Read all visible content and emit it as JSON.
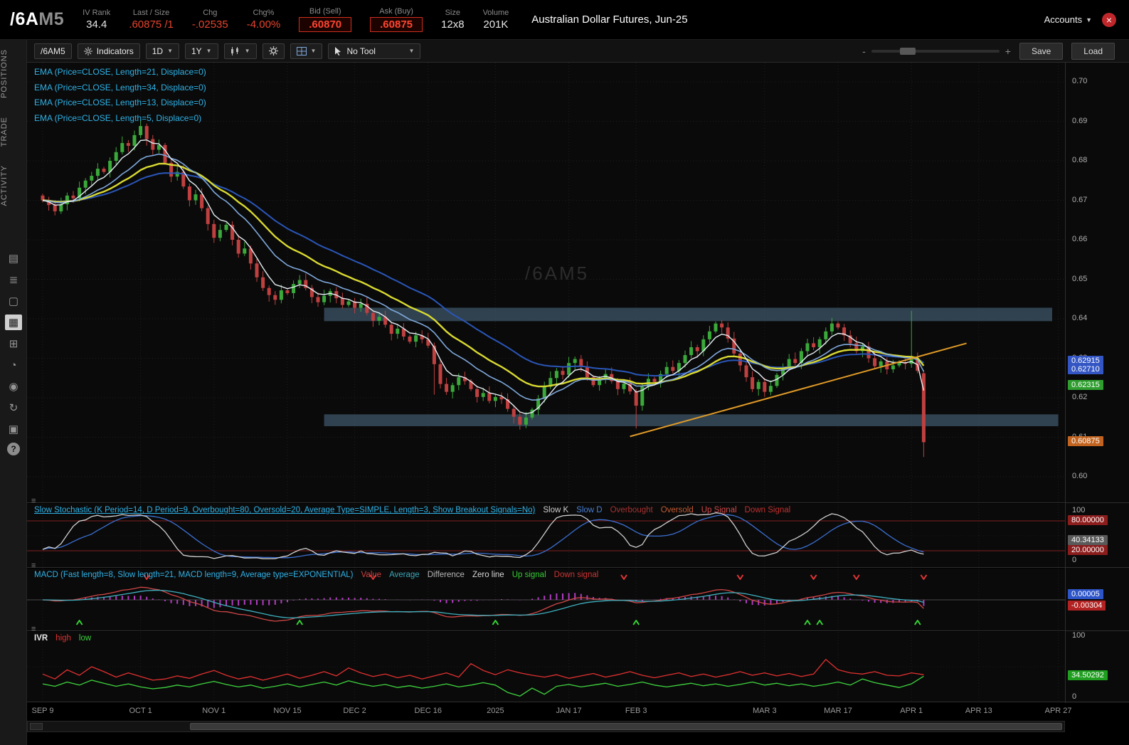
{
  "icons": {
    "caret": "▼",
    "minus": "-",
    "plus": "+",
    "close": "×"
  },
  "header": {
    "symbol_root": "/6A",
    "symbol_suffix": "M5",
    "fields": [
      {
        "label": "IV Rank",
        "value": "34.4"
      },
      {
        "label": "Last / Size",
        "value": ".60875 /1"
      },
      {
        "label": "Chg",
        "value": "-.02535"
      },
      {
        "label": "Chg%",
        "value": "-4.00%"
      },
      {
        "label": "Bid (Sell)",
        "value": ".60870"
      },
      {
        "label": "Ask (Buy)",
        "value": ".60875"
      },
      {
        "label": "Size",
        "value": "12x8"
      },
      {
        "label": "Volume",
        "value": "201K"
      }
    ],
    "description": "Australian Dollar Futures, Jun-25",
    "accounts_label": "Accounts"
  },
  "sidebar": {
    "tabs": [
      "POSITIONS",
      "TRADE",
      "ACTIVITY"
    ],
    "icons": [
      {
        "name": "monitor-icon",
        "glyph": "▤"
      },
      {
        "name": "watchlist-icon",
        "glyph": "≣"
      },
      {
        "name": "tv-icon",
        "glyph": "▢"
      },
      {
        "name": "charts-icon",
        "glyph": "▦",
        "active": true
      },
      {
        "name": "grid-icon",
        "glyph": "⊞"
      },
      {
        "name": "clock-icon",
        "glyph": "◔"
      },
      {
        "name": "people-icon",
        "glyph": "◉"
      },
      {
        "name": "refresh-icon",
        "glyph": "↻"
      },
      {
        "name": "image-icon",
        "glyph": "▣"
      },
      {
        "name": "help-icon",
        "glyph": "?",
        "help": true
      }
    ]
  },
  "toolbar": {
    "symbol": "/6AM5",
    "indicators_label": "Indicators",
    "timeframe": "1D",
    "range": "1Y",
    "tool_label": "No Tool",
    "save_label": "Save",
    "load_label": "Load"
  },
  "chart": {
    "type": "candlestick",
    "watermark": "/6AM5",
    "ema_labels": [
      "EMA (Price=CLOSE, Length=21, Displace=0)",
      "EMA (Price=CLOSE, Length=34, Displace=0)",
      "EMA (Price=CLOSE, Length=13, Displace=0)",
      "EMA (Price=CLOSE, Length=5, Displace=0)"
    ],
    "ema_series": [
      {
        "length": 34,
        "color": "#2a56b8",
        "width": 2
      },
      {
        "length": 21,
        "color": "#d9d932",
        "width": 2.4
      },
      {
        "length": 13,
        "color": "#7fa8dc",
        "width": 1.6
      },
      {
        "length": 5,
        "color": "#e6eef4",
        "width": 1.4
      }
    ],
    "up_color": "#3aa93a",
    "down_color": "#c04040",
    "band_color": "#51718a",
    "price_ticks": [
      0.7,
      0.69,
      0.68,
      0.67,
      0.66,
      0.65,
      0.64,
      0.63,
      0.62,
      0.61,
      0.6
    ],
    "axis_boxes": [
      {
        "text": "0.62915",
        "price": 0.62915,
        "bg": "#3356c4"
      },
      {
        "text": "0.62710",
        "price": 0.6271,
        "bg": "#3356c4"
      },
      {
        "text": "0.62315",
        "price": 0.62315,
        "bg": "#2f9e2f"
      },
      {
        "text": "0.60875",
        "price": 0.60875,
        "bg": "#c2641f"
      }
    ],
    "bands": [
      {
        "i1": 46,
        "i2": 165,
        "p_top": 0.6428,
        "p_bot": 0.6394
      },
      {
        "i1": 46,
        "i2": 166,
        "p_top": 0.6158,
        "p_bot": 0.6128
      }
    ],
    "trendline": {
      "i1": 96,
      "p1": 0.6102,
      "i2": 151,
      "p2": 0.6338,
      "color": "#e09a28"
    },
    "date_ticks": [
      {
        "label": "SEP 9",
        "i": 0
      },
      {
        "label": "OCT 1",
        "i": 16
      },
      {
        "label": "NOV 1",
        "i": 28
      },
      {
        "label": "NOV 15",
        "i": 40
      },
      {
        "label": "DEC 2",
        "i": 51
      },
      {
        "label": "DEC 16",
        "i": 63
      },
      {
        "label": "2025",
        "i": 74
      },
      {
        "label": "JAN 17",
        "i": 86
      },
      {
        "label": "FEB 3",
        "i": 97
      },
      {
        "label": "MAR 3",
        "i": 118
      },
      {
        "label": "MAR 17",
        "i": 130
      },
      {
        "label": "APR 1",
        "i": 142
      },
      {
        "label": "APR 13",
        "i": 153
      },
      {
        "label": "APR 27",
        "i": 166
      }
    ],
    "candles_close": [
      0.67,
      0.6688,
      0.6672,
      0.669,
      0.6712,
      0.6705,
      0.6732,
      0.675,
      0.6762,
      0.678,
      0.6772,
      0.68,
      0.6822,
      0.6845,
      0.6838,
      0.6865,
      0.6888,
      0.6855,
      0.6828,
      0.684,
      0.6795,
      0.676,
      0.6772,
      0.6735,
      0.67,
      0.6715,
      0.668,
      0.664,
      0.6605,
      0.6625,
      0.6638,
      0.66,
      0.6565,
      0.6578,
      0.654,
      0.6505,
      0.6478,
      0.646,
      0.6448,
      0.6472,
      0.6465,
      0.6488,
      0.6498,
      0.6478,
      0.6455,
      0.6442,
      0.6458,
      0.647,
      0.6452,
      0.6435,
      0.6444,
      0.6428,
      0.6438,
      0.6415,
      0.6395,
      0.6405,
      0.6385,
      0.6362,
      0.6375,
      0.6355,
      0.6342,
      0.6358,
      0.6348,
      0.6332,
      0.6285,
      0.6235,
      0.6215,
      0.6232,
      0.6252,
      0.6242,
      0.6222,
      0.6202,
      0.6212,
      0.6192,
      0.6202,
      0.6196,
      0.6172,
      0.6152,
      0.6132,
      0.615,
      0.617,
      0.6198,
      0.6228,
      0.625,
      0.6268,
      0.6258,
      0.6288,
      0.6298,
      0.6278,
      0.6252,
      0.6232,
      0.6246,
      0.626,
      0.6242,
      0.6222,
      0.6236,
      0.6216,
      0.618,
      0.6228,
      0.6248,
      0.624,
      0.626,
      0.6278,
      0.6268,
      0.6288,
      0.6308,
      0.6328,
      0.6318,
      0.6348,
      0.6368,
      0.6388,
      0.6378,
      0.635,
      0.6312,
      0.6282,
      0.6252,
      0.6222,
      0.624,
      0.6215,
      0.623,
      0.6258,
      0.6278,
      0.6298,
      0.6288,
      0.6318,
      0.6338,
      0.6328,
      0.6348,
      0.6368,
      0.6388,
      0.6378,
      0.6358,
      0.6338,
      0.6318,
      0.633,
      0.63,
      0.628,
      0.6292,
      0.6272,
      0.6282,
      0.629,
      0.6286,
      0.6298,
      0.6268,
      0.60875
    ],
    "overrides": {
      "0": {
        "o": 0.6712
      },
      "16": {
        "h": 0.6905
      },
      "64": {
        "l": 0.6208
      },
      "97": {
        "l": 0.6122
      },
      "142": {
        "h": 0.642
      },
      "144": {
        "o": 0.6262,
        "h": 0.627,
        "l": 0.605
      }
    }
  },
  "stoch": {
    "label": "Slow Stochastic (K Period=14, D Period=9, Overbought=80, Oversold=20, Average Type=SIMPLE, Length=3, Show Breakout Signals=No)",
    "legend": [
      {
        "text": "Slow K",
        "color": "#cfcfcf"
      },
      {
        "text": "Slow D",
        "color": "#4a7fd4"
      },
      {
        "text": "Overbought",
        "color": "#a83232"
      },
      {
        "text": "Oversold",
        "color": "#c25a32"
      },
      {
        "text": "Up Signal",
        "color": "#d04848"
      },
      {
        "text": "Down Signal",
        "color": "#c03030"
      }
    ],
    "overbought": 80,
    "oversold": 20,
    "axis_ticks": [
      {
        "text": "100",
        "v": 100
      },
      {
        "text": "0",
        "v": 0
      }
    ],
    "axis_boxes": [
      {
        "text": "80.00000",
        "v": 80,
        "bg": "#8c1d1d"
      },
      {
        "text": "40.34133",
        "v": 40.34,
        "bg": "#5a5a5a"
      },
      {
        "text": "20.00000",
        "v": 20,
        "bg": "#8c1d1d"
      }
    ]
  },
  "macd": {
    "label": "MACD (Fast length=8, Slow length=21, MACD length=9, Average type=EXPONENTIAL)",
    "legend": [
      {
        "text": "Value",
        "color": "#d04040"
      },
      {
        "text": "Average",
        "color": "#3aa8b8"
      },
      {
        "text": "Difference",
        "color": "#b8b8b8"
      },
      {
        "text": "Zero line",
        "color": "#d8d8d8"
      },
      {
        "text": "Up signal",
        "color": "#35cc35"
      },
      {
        "text": "Down signal",
        "color": "#cc3333"
      }
    ],
    "up_signals": [
      6,
      42,
      74,
      97,
      125,
      127,
      143
    ],
    "down_signals": [
      17,
      54,
      95,
      114,
      126,
      133,
      144
    ],
    "axis_boxes": [
      {
        "text": "0.00005",
        "bg": "#2d55c8"
      },
      {
        "text": "-0.00304",
        "bg": "#b22222"
      }
    ]
  },
  "ivr": {
    "label": "IVR",
    "legend": [
      {
        "text": "high",
        "color": "#e03030"
      },
      {
        "text": "low",
        "color": "#3ed43e"
      }
    ],
    "step": 2,
    "high": [
      38,
      30,
      45,
      36,
      50,
      42,
      33,
      40,
      34,
      28,
      30,
      35,
      31,
      38,
      44,
      36,
      30,
      34,
      28,
      33,
      38,
      31,
      36,
      42,
      35,
      48,
      40,
      34,
      38,
      32,
      36,
      30,
      35,
      40,
      33,
      55,
      44,
      37,
      45,
      40,
      36,
      33,
      37,
      31,
      35,
      39,
      33,
      37,
      42,
      36,
      32,
      36,
      40,
      34,
      38,
      33,
      37,
      42,
      36,
      40,
      35,
      39,
      34,
      38,
      62,
      45,
      40,
      38,
      42,
      36,
      35,
      40,
      37
    ],
    "low": [
      22,
      18,
      25,
      20,
      28,
      23,
      18,
      22,
      17,
      14,
      16,
      20,
      17,
      22,
      26,
      21,
      17,
      20,
      15,
      18,
      22,
      17,
      21,
      25,
      20,
      27,
      22,
      18,
      21,
      16,
      19,
      15,
      18,
      22,
      17,
      20,
      24,
      20,
      8,
      2,
      15,
      5,
      18,
      21,
      17,
      20,
      23,
      18,
      21,
      25,
      20,
      17,
      20,
      23,
      19,
      22,
      18,
      21,
      25,
      20,
      23,
      19,
      22,
      18,
      21,
      25,
      20,
      30,
      24,
      20,
      16,
      22,
      34.5
    ],
    "axis_ticks": [
      {
        "text": "100",
        "v": 100
      },
      {
        "text": "0",
        "v": 0
      }
    ],
    "axis_box": {
      "text": "34.50292",
      "v": 34.5,
      "bg": "#1f9e1f"
    }
  }
}
